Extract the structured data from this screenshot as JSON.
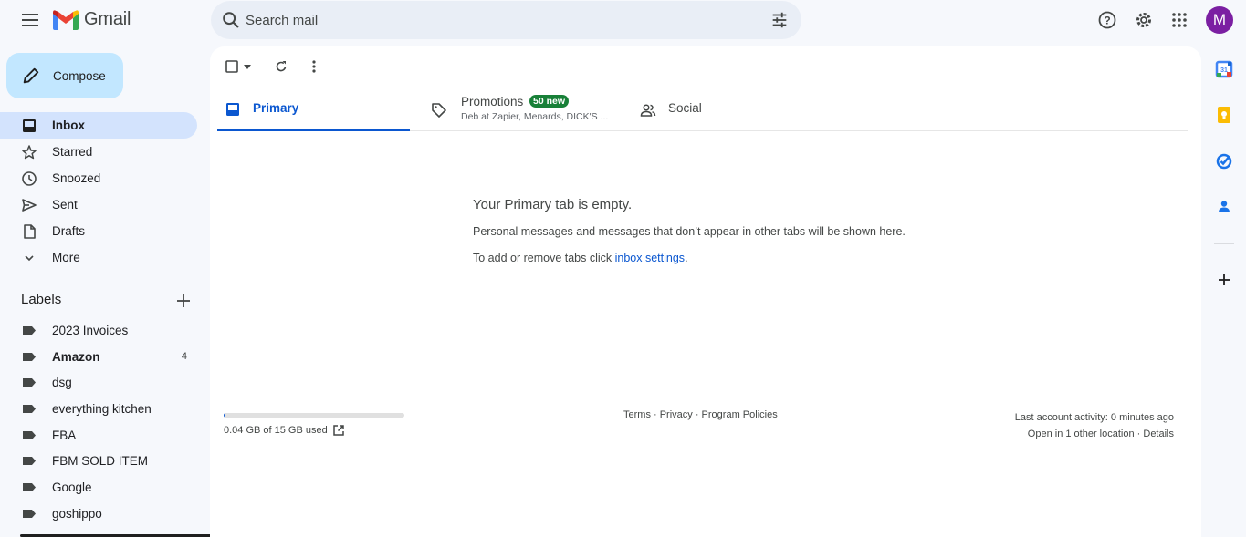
{
  "header": {
    "app_name": "Gmail",
    "search_placeholder": "Search mail",
    "avatar_letter": "M"
  },
  "sidebar": {
    "compose_label": "Compose",
    "items": [
      {
        "label": "Inbox",
        "icon": "inbox-icon",
        "active": true
      },
      {
        "label": "Starred",
        "icon": "star-icon"
      },
      {
        "label": "Snoozed",
        "icon": "clock-icon"
      },
      {
        "label": "Sent",
        "icon": "send-icon"
      },
      {
        "label": "Drafts",
        "icon": "draft-icon"
      },
      {
        "label": "More",
        "icon": "chevron-down-icon"
      }
    ],
    "labels_title": "Labels",
    "labels": [
      {
        "name": "2023 Invoices"
      },
      {
        "name": "Amazon",
        "count": "4",
        "bold": true
      },
      {
        "name": "dsg"
      },
      {
        "name": "everything kitchen"
      },
      {
        "name": "FBA"
      },
      {
        "name": "FBM SOLD ITEM"
      },
      {
        "name": "Google"
      },
      {
        "name": "goshippo"
      }
    ]
  },
  "tabs": {
    "primary": "Primary",
    "promotions": "Promotions",
    "promotions_badge": "50 new",
    "promotions_sub": "Deb at Zapier, Menards, DICK'S ...",
    "social": "Social"
  },
  "empty": {
    "title": "Your Primary tab is empty.",
    "text": "Personal messages and messages that don’t appear in other tabs will be shown here.",
    "text2_prefix": "To add or remove tabs click ",
    "link": "inbox settings",
    "text2_suffix": "."
  },
  "footer": {
    "storage": "0.04 GB of 15 GB used",
    "storage_fraction": 0.003,
    "links": "Terms · Privacy · Program Policies",
    "activity": "Last account activity: 0 minutes ago",
    "location": "Open in 1 other location · Details"
  },
  "colors": {
    "accent": "#0b57d0",
    "compose_bg": "#c2e7ff",
    "active_nav": "#d3e3fd",
    "badge": "#188038",
    "avatar": "#7b1fa2"
  }
}
